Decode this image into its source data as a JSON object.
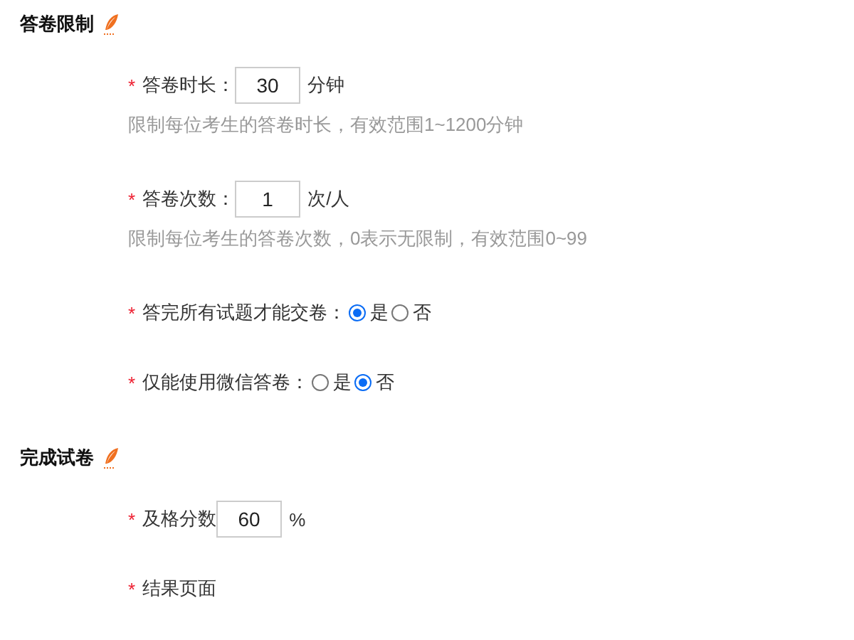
{
  "sections": [
    {
      "title": "答卷限制",
      "items": [
        {
          "kind": "input",
          "marker": "*",
          "label": "答卷时长：",
          "value": "30",
          "unit": "分钟",
          "hint": "限制每位考生的答卷时长，有效范围1~1200分钟"
        },
        {
          "kind": "input",
          "marker": "*",
          "label": "答卷次数：",
          "value": "1",
          "unit": "次/人",
          "hint": "限制每位考生的答卷次数，0表示无限制，有效范围0~99"
        },
        {
          "kind": "radio",
          "marker": "*",
          "label": "答完所有试题才能交卷：",
          "options": [
            {
              "label": "是",
              "selected": true
            },
            {
              "label": "否",
              "selected": false
            }
          ]
        },
        {
          "kind": "radio",
          "marker": "*",
          "label": "仅能使用微信答卷：",
          "options": [
            {
              "label": "是",
              "selected": false
            },
            {
              "label": "否",
              "selected": true
            }
          ]
        }
      ]
    },
    {
      "title": "完成试卷",
      "items": [
        {
          "kind": "input",
          "marker": "*",
          "label": "及格分数",
          "value": "60",
          "unit": "%"
        },
        {
          "kind": "label",
          "marker": "*",
          "label": "结果页面"
        }
      ]
    }
  ]
}
